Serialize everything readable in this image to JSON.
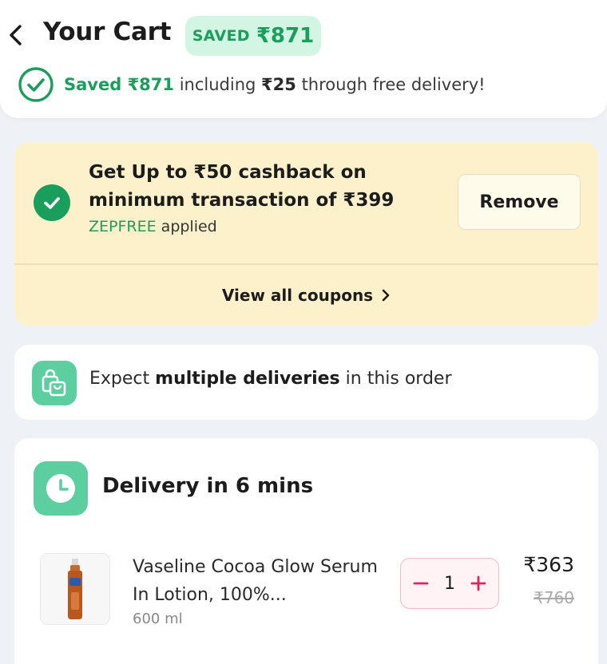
{
  "header": {
    "title": "Your Cart",
    "badge_label": "SAVED",
    "badge_amount": "₹871",
    "savings_prefix": "Saved ₹871",
    "savings_mid": "including",
    "savings_delivery": "₹25",
    "savings_suffix": "through free delivery!"
  },
  "coupon": {
    "title": "Get Up to ₹50 cashback on minimum transaction of ₹399",
    "code": "ZEPFREE",
    "applied_text": "applied",
    "remove_label": "Remove",
    "view_all_label": "View all coupons"
  },
  "notice": {
    "prefix": "Expect",
    "bold": "multiple deliveries",
    "suffix": "in this order"
  },
  "delivery": {
    "title": "Delivery in 6 mins",
    "item": {
      "name": "Vaseline Cocoa Glow Serum In Lotion, 100%...",
      "quantity_label": "600 ml",
      "count": "1",
      "price": "₹363",
      "mrp": "₹760"
    }
  },
  "colors": {
    "accent_green": "#1a9e5c",
    "icon_green": "#5ccea0",
    "coupon_bg": "#fdf1cc",
    "stepper_pink": "#e0245e"
  },
  "icons": {
    "back": "back-arrow-icon",
    "check": "check-circle-icon",
    "bag": "shopping-bags-icon",
    "clock": "clock-icon",
    "chevron": "chevron-right-icon"
  }
}
